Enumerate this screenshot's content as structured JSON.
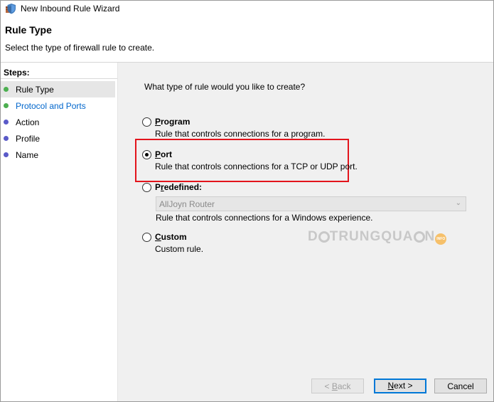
{
  "window": {
    "title": "New Inbound Rule Wizard",
    "icon": "firewall-shield-icon"
  },
  "header": {
    "title": "Rule Type",
    "subtitle": "Select the type of firewall rule to create."
  },
  "steps": {
    "label": "Steps:",
    "items": [
      {
        "label": "Rule Type",
        "state": "current",
        "dot_color": "#4caf50"
      },
      {
        "label": "Protocol and Ports",
        "state": "link",
        "dot_color": "#4caf50"
      },
      {
        "label": "Action",
        "state": "pending",
        "dot_color": "#5a5ac8"
      },
      {
        "label": "Profile",
        "state": "pending",
        "dot_color": "#5a5ac8"
      },
      {
        "label": "Name",
        "state": "pending",
        "dot_color": "#5a5ac8"
      }
    ]
  },
  "main": {
    "question": "What type of rule would you like to create?",
    "selected": "Port",
    "options": [
      {
        "first": "P",
        "rest": "rogram",
        "description": "Rule that controls connections for a program."
      },
      {
        "first": "P",
        "rest": "ort",
        "description": "Rule that controls connections for a TCP or UDP port."
      },
      {
        "pre": "P",
        "first": "r",
        "rest": "edefined:",
        "description": "Rule that controls connections for a Windows experience."
      },
      {
        "first": "C",
        "rest": "ustom",
        "description": "Custom rule."
      }
    ],
    "predefined_select": {
      "value": "AllJoyn Router",
      "icon": "chevron-down-icon"
    }
  },
  "watermark": {
    "pre": "D",
    "post": "TRUNGQUA",
    "tail": "N",
    "badge": "INFO"
  },
  "buttons": {
    "back": {
      "prefix": "< ",
      "underline": "B",
      "rest": "ack"
    },
    "next": {
      "underline": "N",
      "rest": "ext >"
    },
    "cancel": "Cancel"
  },
  "colors": {
    "highlight_border": "#e3141c",
    "link": "#0066cc",
    "default_button_border": "#0078d7"
  }
}
